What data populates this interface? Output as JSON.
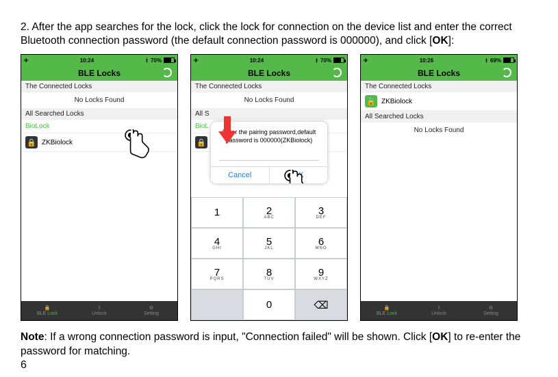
{
  "step": {
    "number": "2.",
    "text_a": "After the app searches for the lock, click the lock for connection on the device list and enter the correct Bluetooth connection password (the default connection password is 000000), and click [",
    "ok": "OK",
    "text_b": "]:"
  },
  "phone_common": {
    "title": "BLE Locks",
    "section_connected": "The Connected Locks",
    "section_searched": "All Searched Locks",
    "no_locks": "No Locks Found",
    "biolock": "BioLock",
    "zkbiolock": "ZKBiolock",
    "tabs": {
      "ble": "BLE Lock",
      "unlock": "Unlock",
      "setting": "Setting"
    }
  },
  "phones": [
    {
      "time": "10:24",
      "batt": "70%",
      "connected_empty": true
    },
    {
      "time": "10:24",
      "batt": "70%"
    },
    {
      "time": "10:26",
      "batt": "69%"
    }
  ],
  "dialog": {
    "msg": "Enter the pairing password,default password is 000000(ZKBiolock)",
    "cancel": "Cancel",
    "ok": "OK"
  },
  "keypad": [
    {
      "n": "1",
      "s": ""
    },
    {
      "n": "2",
      "s": "ABC"
    },
    {
      "n": "3",
      "s": "DEF"
    },
    {
      "n": "4",
      "s": "GHI"
    },
    {
      "n": "5",
      "s": "JKL"
    },
    {
      "n": "6",
      "s": "MNO"
    },
    {
      "n": "7",
      "s": "PQRS"
    },
    {
      "n": "8",
      "s": "TUV"
    },
    {
      "n": "9",
      "s": "WXYZ"
    },
    {
      "n": "",
      "s": "",
      "grey": true
    },
    {
      "n": "0",
      "s": ""
    },
    {
      "n": "⌫",
      "s": "",
      "grey": true
    }
  ],
  "note": {
    "label": "Note",
    "text_a": ": If a wrong connection password is input, \"Connection failed\" will be shown. Click [",
    "ok": "OK",
    "text_b": "] to re-enter the password for matching."
  },
  "page": "6"
}
